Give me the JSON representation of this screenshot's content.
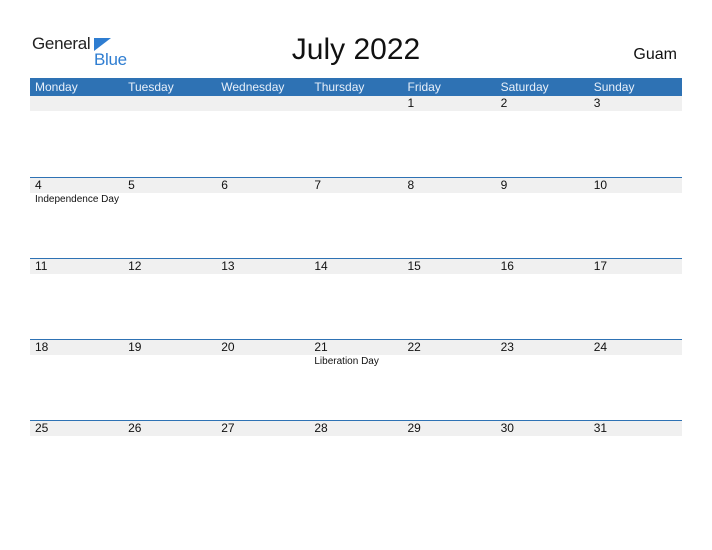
{
  "logo": {
    "text_general": "General",
    "text_blue": "Blue",
    "icon": "triangle-flag-icon"
  },
  "title": "July 2022",
  "country": "Guam",
  "colors": {
    "header_bg": "#2e72b4",
    "date_strip_bg": "#f0f0f0",
    "logo_blue": "#2e7dd1"
  },
  "weekdays": [
    "Monday",
    "Tuesday",
    "Wednesday",
    "Thursday",
    "Friday",
    "Saturday",
    "Sunday"
  ],
  "weeks": [
    {
      "days": [
        "",
        "",
        "",
        "",
        "1",
        "2",
        "3"
      ],
      "holidays": [
        "",
        "",
        "",
        "",
        "",
        "",
        ""
      ]
    },
    {
      "days": [
        "4",
        "5",
        "6",
        "7",
        "8",
        "9",
        "10"
      ],
      "holidays": [
        "Independence Day",
        "",
        "",
        "",
        "",
        "",
        ""
      ]
    },
    {
      "days": [
        "11",
        "12",
        "13",
        "14",
        "15",
        "16",
        "17"
      ],
      "holidays": [
        "",
        "",
        "",
        "",
        "",
        "",
        ""
      ]
    },
    {
      "days": [
        "18",
        "19",
        "20",
        "21",
        "22",
        "23",
        "24"
      ],
      "holidays": [
        "",
        "",
        "",
        "Liberation Day",
        "",
        "",
        ""
      ]
    },
    {
      "days": [
        "25",
        "26",
        "27",
        "28",
        "29",
        "30",
        "31"
      ],
      "holidays": [
        "",
        "",
        "",
        "",
        "",
        "",
        ""
      ]
    }
  ]
}
